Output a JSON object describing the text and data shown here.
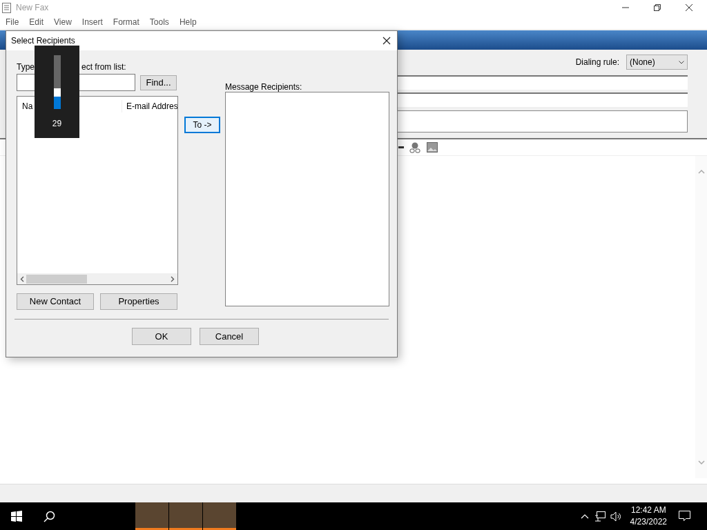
{
  "window": {
    "title": "New Fax"
  },
  "menu": [
    "File",
    "Edit",
    "View",
    "Insert",
    "Format",
    "Tools",
    "Help"
  ],
  "fax_form": {
    "dialing_rule_label": "Dialing rule:",
    "dialing_rule_value": "(None)"
  },
  "dialog": {
    "title": "Select Recipients",
    "type_label_parts": [
      "Type",
      "ect from list:"
    ],
    "find_button": "Find...",
    "columns": [
      "Na",
      "E-mail Addres"
    ],
    "to_button": "To ->",
    "recipients_label": "Message Recipients:",
    "buttons_left": [
      "New Contact",
      "Properties"
    ],
    "ok": "OK",
    "cancel": "Cancel"
  },
  "volume_flyout": {
    "level": 0.29,
    "reading": "29"
  },
  "clock": {
    "time": "12:42 AM",
    "date": "4/23/2022"
  }
}
